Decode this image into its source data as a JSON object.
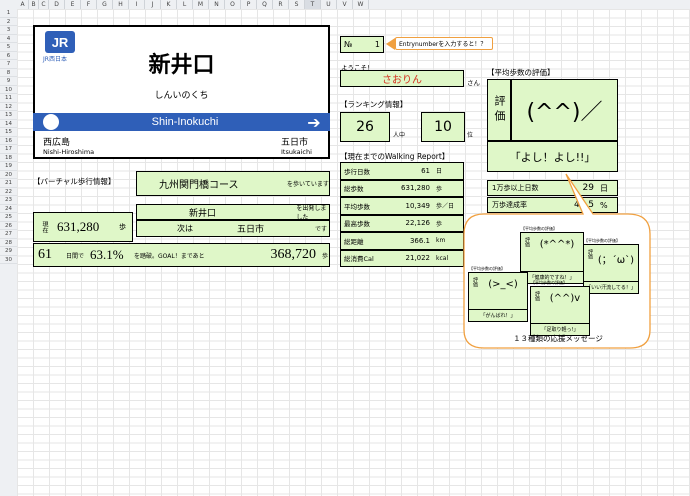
{
  "columns": [
    "A",
    "B",
    "C",
    "D",
    "E",
    "F",
    "G",
    "H",
    "I",
    "J",
    "K",
    "L",
    "M",
    "N",
    "O",
    "P",
    "Q",
    "R",
    "S",
    "T",
    "U",
    "V",
    "W"
  ],
  "selected_column": "T",
  "rows": [
    "1",
    "2",
    "3",
    "4",
    "5",
    "6",
    "7",
    "8",
    "9",
    "10",
    "11",
    "12",
    "13",
    "14",
    "15",
    "16",
    "17",
    "18",
    "19",
    "20",
    "21",
    "22",
    "23",
    "24",
    "25",
    "26",
    "27",
    "28",
    "29",
    "30"
  ],
  "station_sign": {
    "logo_text": "JR西日本",
    "name": "新井口",
    "kana": "しんいのくち",
    "romaji": "Shin-Inokuchi",
    "prev_name": "西広島",
    "prev_romaji": "Nishi-Hiroshima",
    "next_name": "五日市",
    "next_romaji": "Itsukaichi"
  },
  "entry": {
    "no_label": "№",
    "no_value": "1",
    "arrow_note": "Entrynumberを入力すると！？",
    "welcome_label": "ようこそ！",
    "user_name": "さおりん",
    "san": "さん"
  },
  "ranking": {
    "header": "【ランキング情報】",
    "rank_a": "26",
    "rank_a_unit": "人中",
    "rank_b": "10",
    "rank_b_unit": "位"
  },
  "walking_report": {
    "header": "【現在までのWalking Report】",
    "rows": [
      {
        "label": "歩行日数",
        "value": "61",
        "unit": "日"
      },
      {
        "label": "総歩数",
        "value": "631,280",
        "unit": "歩"
      },
      {
        "label": "平均歩数",
        "value": "10,349",
        "unit": "歩／日"
      },
      {
        "label": "最高歩数",
        "value": "22,126",
        "unit": "歩"
      },
      {
        "label": "総距離",
        "value": "366.1",
        "unit": "km"
      },
      {
        "label": "総消費Cal",
        "value": "21,022",
        "unit": "kcal"
      }
    ]
  },
  "evaluation": {
    "header": "【平均歩数の評価】",
    "label": "評価",
    "face": "(^^)／",
    "message": "「よし！よし!!」"
  },
  "stats": {
    "over10k_label": "1万歩以上日数",
    "over10k_value": "29",
    "over10k_unit": "日",
    "achieve_label": "万歩達成率",
    "achieve_value": "47.5",
    "achieve_unit": "%"
  },
  "virtual": {
    "header": "【バーチャル歩行情報】",
    "course": "九州関門橋コース",
    "course_suffix": "を歩いています",
    "departed": "新井口",
    "departed_suffix": "を出発しました",
    "next_label": "次は",
    "next_station": "五日市",
    "next_suffix": "です",
    "current_label": "現在",
    "current_steps": "631,280",
    "steps_unit": "歩",
    "days": "61",
    "days_label": "日間で",
    "percent": "63.1%",
    "percent_label": "を踏破。GOAL！まであと",
    "remaining": "368,720",
    "remaining_unit": "歩"
  },
  "cheer": {
    "caption": "１３種類の応援メッセージ",
    "mini_header": "【平均歩数の評価】",
    "eval_label": "評価",
    "cards": [
      {
        "face": "(*^^*)",
        "message": "「健康的ですね！」"
      },
      {
        "face": "(；´ω`)",
        "message": "「いい汗流してる！」"
      },
      {
        "face": "(>_<)",
        "message": "「がんばれ！」"
      },
      {
        "face": "(^^)v",
        "message": "「足取り軽っ!」"
      }
    ]
  },
  "colors": {
    "accent_blue": "#2f5fb8",
    "cell_green": "#dff7c8",
    "callout_orange": "#f0a040",
    "rank_text_red": "#d43020"
  }
}
